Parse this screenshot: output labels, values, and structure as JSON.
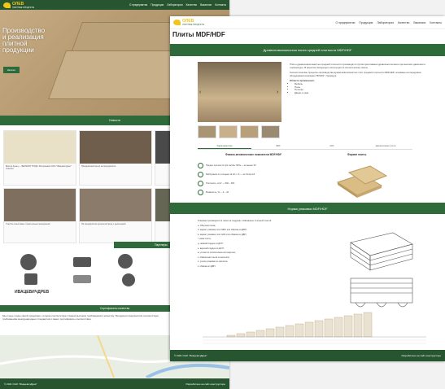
{
  "brand": {
    "name": "ОЛЕВ",
    "tagline": "ПЛИТНЫЕ ПРОДУКТЫ",
    "color": "#2f6b3a",
    "accent": "#f3c41b"
  },
  "back_page": {
    "nav": [
      "О предприятии",
      "Продукция",
      "Лаборатория",
      "Качество",
      "Вакансии",
      "Контакты"
    ],
    "hero": {
      "title": "Производство\nи реализация\nплитной\nпродукции",
      "button": "Каталог"
    },
    "news_title": "Новости",
    "news": [
      "Виктор Кунец — ВЕТЕРАН ТРУДА. Ветеранами ОАО \"Ивацевичдрев\" отмечен",
      "Праздничный вечер на предприятии",
      "",
      "Участие в выставке строительных материалов",
      "На предприятии прошла встреча с делегацией",
      ""
    ],
    "partners_title": "Партнеры",
    "partners": [
      "ИВАЦЕВИЧДРЕВ"
    ],
    "certs_title": "Сертификаты качества",
    "certs_text": "Мы очень горды своей продукции, которая соответствует самым высоким требованиям к качеству. Продукция предприятия соответствует требованиям международных стандартов и имеет сертификаты соответствия.",
    "footer": "© 2021 ОАО \"ИвацевичДрев\"",
    "footer_right": "Разработано на сайт-конструкторе"
  },
  "front_page": {
    "nav": [
      "О предприятии",
      "Продукция",
      "Лаборатория",
      "Качество",
      "Вакансии",
      "Контакты"
    ],
    "title": "Плиты MDF/HDF",
    "band": "Древесноволокнистая плита средней плотности MDF/HDF",
    "description": [
      "Плиты древесноволокнистые средней плотности производятся путём прессования древесных волокон при высоких давлении и температуре. В качестве связующего используются синтетические смолы.",
      "Технологические процессы производства древесноволокнистых плит средней плотности MDF/HDF основаны на передовом оборудовании компании \"BISON\", Германия."
    ],
    "areas_title": "Области применения:",
    "areas": [
      "Мебель",
      "Полы",
      "Потолки",
      "Двери и окна"
    ],
    "tabs": [
      "Характеристики",
      "MDF",
      "HDF",
      "Декоративная плита"
    ],
    "props_title": "Физико-механические показатели MDF/HDF",
    "props": [
      "Предел прочности при изгибе, МПа — не менее 30",
      "Разбухание по толщине за 24 ч, % — не более 18",
      "Плотность, кг/м³ — 600 – 900",
      "Влажность, % — 4 – 10"
    ],
    "format_title": "Формат плиты",
    "pack_title": "Норма упаковки MDF/HDF",
    "pack_intro": "Упаковка производится в пачки на поддонах, обвязанных стальной лентой.",
    "pack_items": [
      "а. Обычная пачка;",
      "б. каркас упаковки плит MDF или обвязка из ДВП;",
      "в. каркас упаковки плит HDF или обвязка из ДВП;",
      "г. сама плита;",
      "д. нижний поддон из ДСП;",
      "е. верхний поддон из ДСП;",
      "ж. уголки из полиэтилена или картона;",
      "з. обвязочная лента из металла;",
      "и. уголки упаковки из металла;",
      "к. обвязка из ДВП."
    ],
    "footer": "© 2021 ОАО \"ИвацевичДрев\"",
    "footer_right": "Разработано на сайт-конструкторе"
  }
}
